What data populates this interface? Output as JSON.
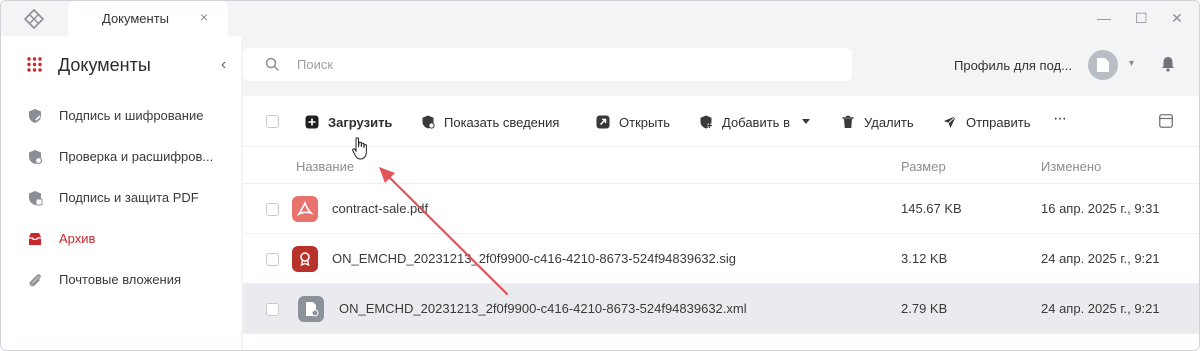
{
  "window": {
    "tab_label": "Документы",
    "tab_close": "×",
    "minimize": "—",
    "maximize": "☐",
    "close": "✕"
  },
  "sidebar": {
    "title": "Документы",
    "collapse_icon": "‹",
    "items": [
      {
        "label": "Подпись и шифрование",
        "icon": "shield-pen-icon",
        "active": false
      },
      {
        "label": "Проверка и расшифров...",
        "icon": "shield-check-icon",
        "active": false
      },
      {
        "label": "Подпись и защита PDF",
        "icon": "shield-pdf-icon",
        "active": false
      },
      {
        "label": "Архив",
        "icon": "archive-box-icon",
        "active": true
      },
      {
        "label": "Почтовые вложения",
        "icon": "paperclip-icon",
        "active": false
      }
    ]
  },
  "header": {
    "search_placeholder": "Поиск",
    "profile_label": "Профиль для под...",
    "caret": "▾"
  },
  "toolbar": {
    "upload": "Загрузить",
    "details": "Показать сведения",
    "open": "Открыть",
    "add_to": "Добавить в",
    "delete": "Удалить",
    "send": "Отправить",
    "more": "···"
  },
  "table": {
    "columns": {
      "name": "Название",
      "size": "Размер",
      "modified": "Изменено"
    },
    "rows": [
      {
        "name": "contract-sale.pdf",
        "size": "145.67 KB",
        "modified": "16 апр. 2025 г., 9:31",
        "icon": "pdf-file-icon",
        "selected": false
      },
      {
        "name": "ON_EMCHD_20231213_2f0f9900-c416-4210-8673-524f94839632.sig",
        "size": "3.12 KB",
        "modified": "24 апр. 2025 г., 9:21",
        "icon": "signature-file-icon",
        "selected": false
      },
      {
        "name": "ON_EMCHD_20231213_2f0f9900-c416-4210-8673-524f94839632.xml",
        "size": "2.79 KB",
        "modified": "24 апр. 2025 г., 9:21",
        "icon": "xml-file-icon",
        "selected": true
      }
    ]
  },
  "colors": {
    "accent": "#c8262b",
    "pdf": "#e8736c",
    "sig": "#b8312b",
    "xml": "#8c9299",
    "arrow": "#e0555a"
  }
}
